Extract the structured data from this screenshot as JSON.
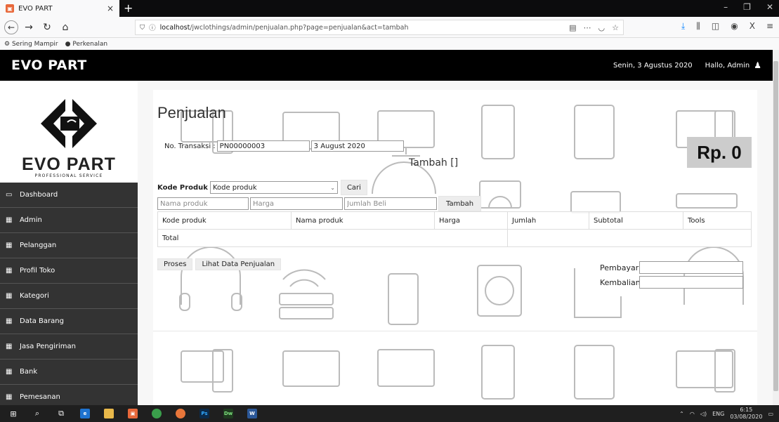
{
  "browser": {
    "tab_title": "EVO PART",
    "tab_close": "×",
    "new_tab": "+",
    "url_host": "localhost",
    "url_path": "/jwclothings/admin/penjualan.php?page=penjualan&act=tambah",
    "bookmarks": [
      "Sering Mampir",
      "Perkenalan"
    ]
  },
  "header": {
    "brand": "EVO PART",
    "date": "Senin, 3 Agustus 2020",
    "greeting": "Hallo, Admin"
  },
  "logo": {
    "wordmark": "EVO PART",
    "tagline": "PROFESSIONAL SERVICE"
  },
  "sidebar": {
    "items": [
      {
        "label": "Dashboard",
        "icon": "monitor-icon"
      },
      {
        "label": "Admin",
        "icon": "table-icon"
      },
      {
        "label": "Pelanggan",
        "icon": "table-icon"
      },
      {
        "label": "Profil Toko",
        "icon": "table-icon"
      },
      {
        "label": "Kategori",
        "icon": "table-icon"
      },
      {
        "label": "Data Barang",
        "icon": "table-icon"
      },
      {
        "label": "Jasa Pengiriman",
        "icon": "table-icon"
      },
      {
        "label": "Bank",
        "icon": "table-icon"
      },
      {
        "label": "Pemesanan",
        "icon": "table-icon"
      }
    ]
  },
  "form": {
    "title": "Penjualan",
    "transaksi_label": "No. Transaksi :",
    "transaksi_value": "PN00000003",
    "date_value": "3 August 2020",
    "tambah_title": "Tambah []",
    "total_display": "Rp. 0",
    "kode_label": "Kode Produk",
    "kode_select": "Kode produk",
    "cari_button": "Cari",
    "nama_placeholder": "Nama produk",
    "harga_placeholder": "Harga",
    "jumlah_placeholder": "Jumlah Beli",
    "tambah_button": "Tambah"
  },
  "table": {
    "headers": [
      "Kode produk",
      "Nama produk",
      "Harga",
      "Jumlah",
      "Subtotal",
      "Tools"
    ],
    "total_label": "Total"
  },
  "actions": {
    "proses": "Proses",
    "lihat": "Lihat Data Penjualan",
    "pembayaran_label": "Pembayaran",
    "kembalian_label": "Kembalian"
  },
  "taskbar": {
    "lang": "ENG",
    "time": "6:15",
    "date": "03/08/2020"
  },
  "colors": {
    "header_bg": "#000000",
    "sidebar_bg": "#333333",
    "rp_box": "#cccccc"
  }
}
